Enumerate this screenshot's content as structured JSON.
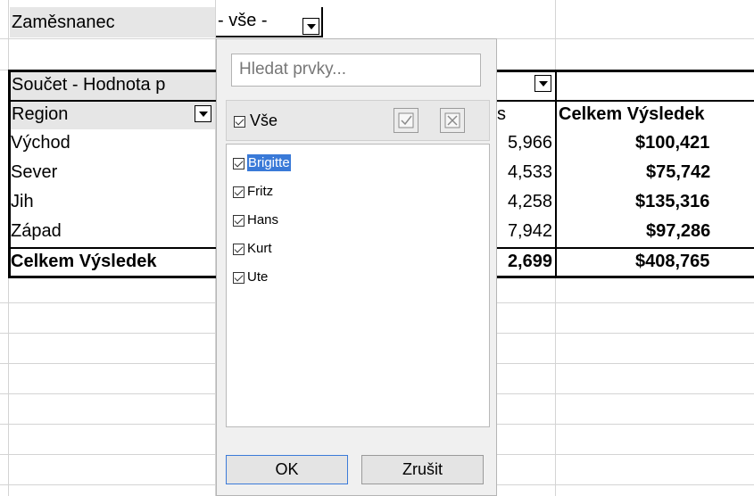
{
  "sheet": {
    "filter_label": "Zaměsnanec",
    "filter_value": "- vše -",
    "data_field": "Součet - Hodnota p",
    "col_header": "Region",
    "col_partial": "s",
    "total_header": "Celkem Výsledek",
    "rows": [
      {
        "label": "Východ",
        "partial": "5,966",
        "total": "$100,421"
      },
      {
        "label": "Sever",
        "partial": "4,533",
        "total": "$75,742"
      },
      {
        "label": "Jih",
        "partial": "4,258",
        "total": "$135,316"
      },
      {
        "label": "Západ",
        "partial": "7,942",
        "total": "$97,286"
      }
    ],
    "grand": {
      "label": "Celkem Výsledek",
      "partial": "2,699",
      "total": "$408,765"
    }
  },
  "popup": {
    "search_placeholder": "Hledat prvky...",
    "all_label": "Vše",
    "items": [
      "Brigitte",
      "Fritz",
      "Hans",
      "Kurt",
      "Ute"
    ],
    "ok_label": "OK",
    "cancel_label": "Zrušit"
  },
  "icons": [
    "checkbox-icon",
    "check-all-icon",
    "uncheck-all-icon",
    "dropdown-arrow-icon"
  ]
}
